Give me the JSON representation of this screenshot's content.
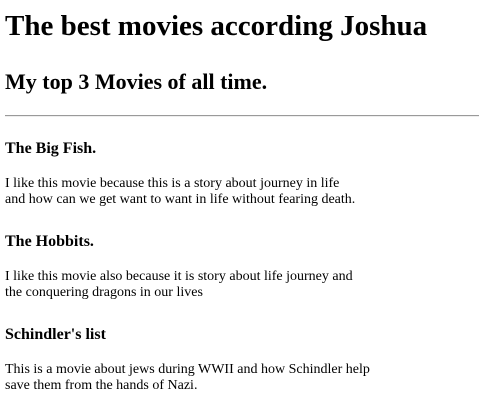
{
  "page": {
    "title": "The best movies according Joshua",
    "subtitle": "My top 3 Movies of all time."
  },
  "movies": [
    {
      "name": "The Big Fish.",
      "description_line1": "I like this movie because this is a story about journey in life",
      "description_line2": "and how can we get want to want in life without fearing death."
    },
    {
      "name": "The Hobbits.",
      "description_line1": "I like this movie also because it is story about life journey and",
      "description_line2": "the conquering dragons in our lives"
    },
    {
      "name": "Schindler's list",
      "description_line1": "This is a movie about jews during WWII and how Schindler help",
      "description_line2": "save them from the hands of Nazi."
    }
  ]
}
